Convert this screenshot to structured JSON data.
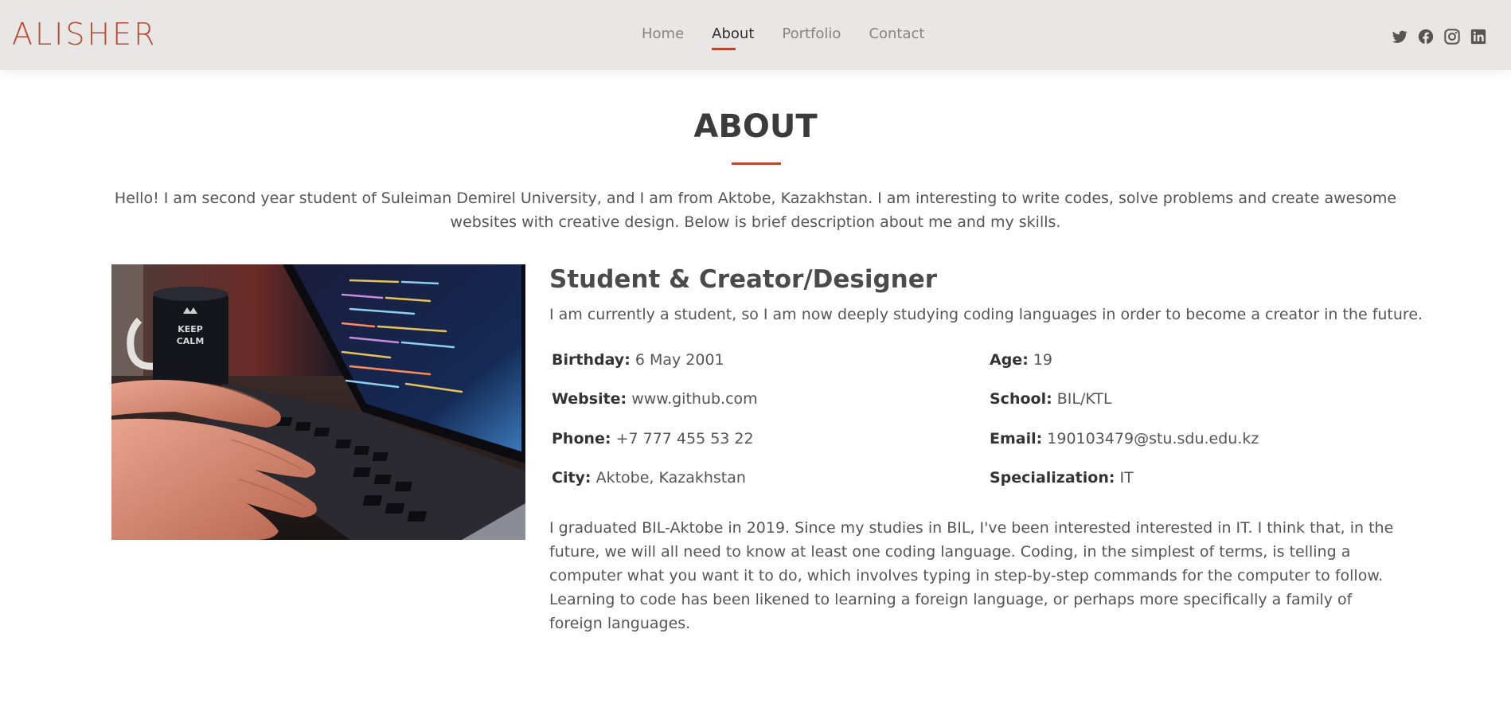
{
  "header": {
    "logo": "ALISHER",
    "nav": [
      {
        "label": "Home",
        "active": false
      },
      {
        "label": "About",
        "active": true
      },
      {
        "label": "Portfolio",
        "active": false
      },
      {
        "label": "Contact",
        "active": false
      }
    ],
    "social": [
      "twitter-icon",
      "facebook-icon",
      "instagram-icon",
      "linkedin-icon"
    ]
  },
  "colors": {
    "accent": "#b9482f",
    "header_bg": "#e8e7e5",
    "text": "#555555",
    "heading": "#3b3b3b"
  },
  "about": {
    "title": "ABOUT",
    "intro": "Hello! I am second year student of Suleiman Demirel University, and I am from Aktobe, Kazakhstan. I am interesting to write codes, solve problems and create awesome websites with creative design. Below is brief description about me and my skills.",
    "subtitle": "Student & Creator/Designer",
    "lead": "I am currently a student, so I am now deeply studying coding languages in order to become a creator in the future.",
    "info": {
      "birthday_label": "Birthday:",
      "birthday": "6 May 2001",
      "age_label": "Age:",
      "age": "19",
      "website_label": "Website:",
      "website": "www.github.com",
      "school_label": "School:",
      "school": "BIL/KTL",
      "phone_label": "Phone:",
      "phone": "+7 777 455 53 22",
      "email_label": "Email:",
      "email": "190103479@stu.sdu.edu.kz",
      "city_label": "City:",
      "city": "Aktobe, Kazakhstan",
      "specialization_label": "Specialization:",
      "specialization": "IT"
    },
    "body": "I graduated BIL-Aktobe in 2019. Since my studies in BIL, I've been interested interested in IT. I think that, in the future, we will all need to know at least one coding language. Coding, in the simplest of terms, is telling a computer what you want it to do, which involves typing in step-by-step commands for the computer to follow. Learning to code has been likened to learning a foreign language, or perhaps more specifically a family of foreign languages."
  }
}
